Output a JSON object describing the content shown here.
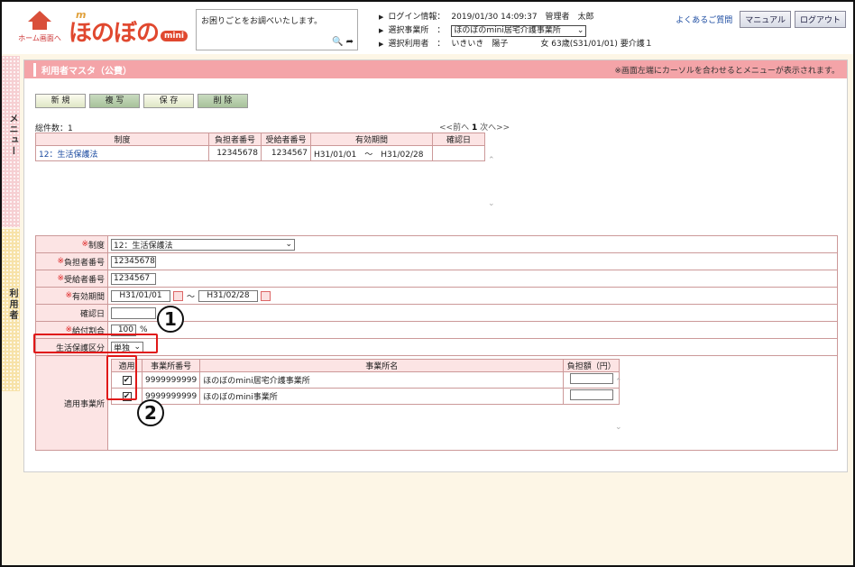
{
  "header": {
    "home_label": "ホーム画面へ",
    "logo_m": "m",
    "logo_text": "ほのぼの",
    "logo_mini": "mini",
    "help_text": "お困りごとをお調べいたします。",
    "login_label": "ログイン情報：",
    "login_value": "2019/01/30 14:09:37　管理者　太郎",
    "office_label": "選択事業所　：",
    "office_value": "ほのぼのmini居宅介護事業所",
    "user_label": "選択利用者　：",
    "user_value": "いきいき　陽子　　　　女 63歳(S31/01/01) 要介護１",
    "faq": "よくあるご質問",
    "manual": "マニュアル",
    "logout": "ログアウト"
  },
  "side": {
    "menu": "メニュー",
    "user": "利用者"
  },
  "panel": {
    "title": "利用者マスタ（公費）",
    "note": "※画面左端にカーソルを合わせるとメニューが表示されます。",
    "buttons": {
      "new": "新 規",
      "copy": "複 写",
      "save": "保 存",
      "delete": "削 除"
    },
    "total": "総件数：1",
    "pager_prev": "<<前へ",
    "pager_page": "1",
    "pager_next": "次へ>>"
  },
  "list": {
    "headers": [
      "制度",
      "負担者番号",
      "受給者番号",
      "有効期間",
      "確認日"
    ],
    "rows": [
      {
        "seido": "12：生活保護法",
        "payer": "12345678",
        "recipient": "1234567",
        "from": "H31/01/01",
        "tilde": "～",
        "to": "H31/02/28",
        "confirm": ""
      }
    ]
  },
  "form": {
    "seido_label": "制度",
    "seido_value": "12：生活保護法",
    "payer_label": "負担者番号",
    "payer_value": "12345678",
    "recipient_label": "受給者番号",
    "recipient_value": "1234567",
    "period_label": "有効期間",
    "period_from": "H31/01/01",
    "period_tilde": "～",
    "period_to": "H31/02/28",
    "confirm_label": "確認日",
    "rate_label": "給付割合",
    "rate_value": "100",
    "rate_unit": "%",
    "welfare_label": "生活保護区分",
    "welfare_value": "単独",
    "req_mark": "※"
  },
  "apply": {
    "label": "適用事業所",
    "headers": [
      "適用",
      "事業所番号",
      "事業所名",
      "負担額（円）"
    ],
    "rows": [
      {
        "checked": "✔",
        "number": "9999999999",
        "name": "ほのぼのmini居宅介護事業所"
      },
      {
        "checked": "✔",
        "number": "9999999999",
        "name": "ほのぼのmini事業所"
      }
    ]
  },
  "callouts": {
    "one": "1",
    "two": "2"
  },
  "colors": {
    "title_bar": "#f4a4a8",
    "highlight": "#e01818",
    "header_cell": "#fce4e4"
  }
}
